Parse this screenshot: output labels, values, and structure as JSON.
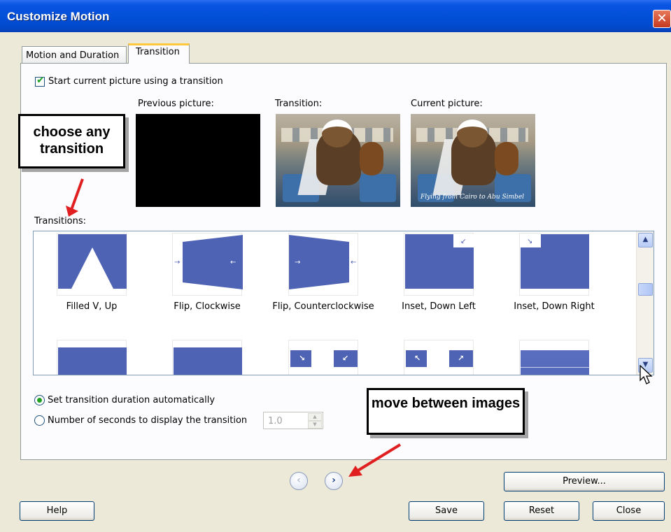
{
  "window": {
    "title": "Customize Motion",
    "close_glyph": "✕"
  },
  "tabs": [
    {
      "label": "Motion and Duration",
      "active": false
    },
    {
      "label": "Transition",
      "active": true
    }
  ],
  "start_checkbox": {
    "label": "Start current picture using a transition",
    "checked": true
  },
  "previews": {
    "previous_label": "Previous picture:",
    "transition_label": "Transition:",
    "current_label": "Current picture:",
    "current_caption": "Flying from Cairo to Abu Simbel"
  },
  "transitions_label": "Transitions:",
  "transitions": [
    {
      "label": "Filled V, Up",
      "icon": "filled-v-up"
    },
    {
      "label": "Flip, Clockwise",
      "icon": "flip-clockwise"
    },
    {
      "label": "Flip, Counterclockwise",
      "icon": "flip-counterclockwise"
    },
    {
      "label": "Inset, Down Left",
      "icon": "inset-down-left"
    },
    {
      "label": "Inset, Down Right",
      "icon": "inset-down-right"
    }
  ],
  "duration": {
    "auto_label": "Set transition duration automatically",
    "auto_selected": true,
    "seconds_label": "Number of seconds to display the transition",
    "seconds_value": "1.0"
  },
  "callouts": {
    "choose": "choose any transition",
    "move": "move between images"
  },
  "buttons": {
    "preview": "Preview...",
    "help": "Help",
    "save": "Save",
    "reset": "Reset",
    "close": "Close",
    "prev_glyph": "‹",
    "next_glyph": "›"
  },
  "colors": {
    "accent": "#4f63b4",
    "titlebar": "#0350d8",
    "annotation_arrow": "#e02020"
  }
}
